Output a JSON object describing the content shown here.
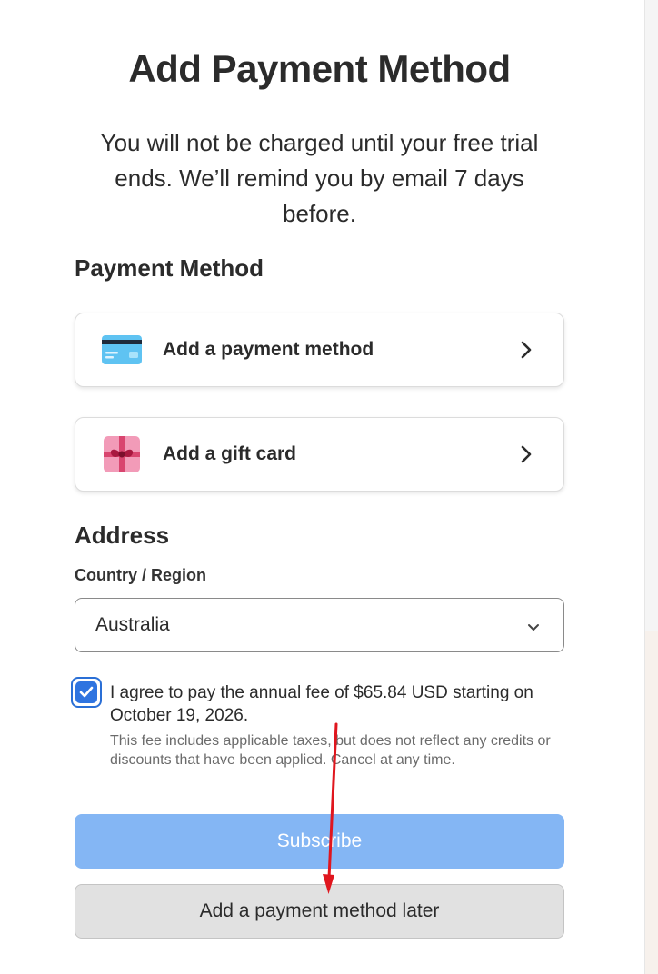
{
  "header": {
    "title": "Add Payment Method",
    "subtitle": "You will not be charged until your free trial ends. We’ll remind you by email 7 days before."
  },
  "payment_section": {
    "title": "Payment Method",
    "options": [
      {
        "label": "Add a payment method",
        "icon": "credit-card-icon"
      },
      {
        "label": "Add a gift card",
        "icon": "gift-icon"
      }
    ]
  },
  "address_section": {
    "title": "Address",
    "country_label": "Country / Region",
    "country_value": "Australia"
  },
  "agreement": {
    "checked": true,
    "text": "I agree to pay the annual fee of $65.84 USD starting on October 19, 2026.",
    "note": "This fee includes applicable taxes, but does not reflect any credits or discounts that have been applied. Cancel at any time."
  },
  "buttons": {
    "subscribe": "Subscribe",
    "later": "Add a payment method later"
  },
  "colors": {
    "accent": "#2f74e0",
    "subscribe_bg": "#84b6f4",
    "annotation_arrow": "#e0161e"
  }
}
